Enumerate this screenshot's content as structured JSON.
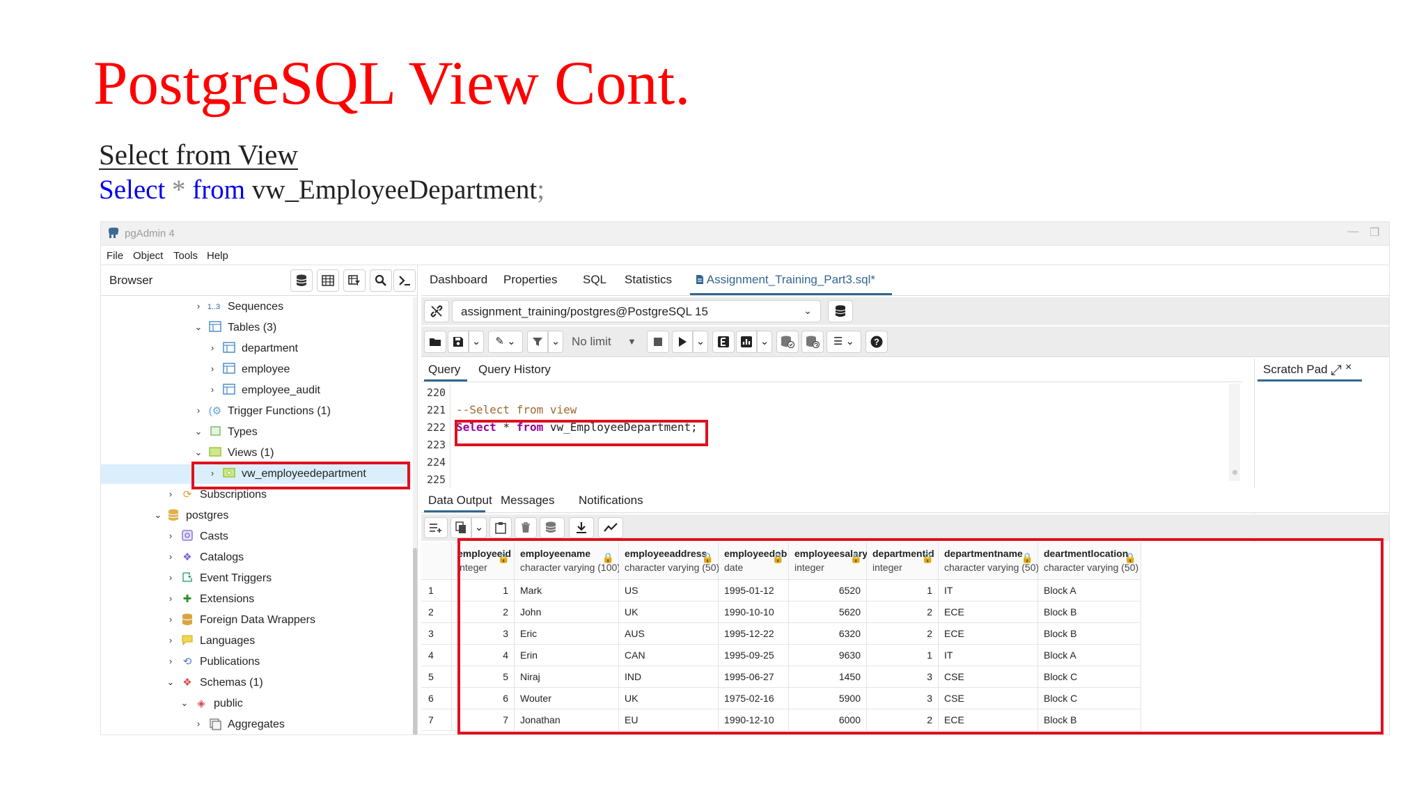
{
  "slide": {
    "title": "PostgreSQL View Cont.",
    "subtitle": "Select from View",
    "code": {
      "kw1": "Select",
      "op": " * ",
      "kw2": "from",
      "ident": " vw_EmployeeDepartment",
      "semi": ";"
    }
  },
  "window": {
    "app_name": "pgAdmin 4",
    "menu": [
      "File",
      "Object",
      "Tools",
      "Help"
    ]
  },
  "browser": {
    "title": "Browser",
    "tree": [
      {
        "label": "Sequences",
        "prefix": "1..3",
        "icon": "sequence-icon"
      },
      {
        "label": "Tables (3)",
        "icon": "table-icon"
      },
      {
        "label": "department",
        "icon": "table-icon"
      },
      {
        "label": "employee",
        "icon": "table-icon"
      },
      {
        "label": "employee_audit",
        "icon": "table-icon"
      },
      {
        "label": "Trigger Functions (1)",
        "icon": "trigger-function-icon"
      },
      {
        "label": "Types",
        "icon": "types-icon"
      },
      {
        "label": "Views (1)",
        "icon": "views-icon"
      },
      {
        "label": "vw_employeedepartment",
        "icon": "view-icon"
      },
      {
        "label": "Subscriptions",
        "icon": "subscriptions-icon"
      },
      {
        "label": "postgres",
        "icon": "database-icon"
      },
      {
        "label": "Casts",
        "icon": "casts-icon"
      },
      {
        "label": "Catalogs",
        "icon": "catalogs-icon"
      },
      {
        "label": "Event Triggers",
        "icon": "event-triggers-icon"
      },
      {
        "label": "Extensions",
        "icon": "extensions-icon"
      },
      {
        "label": "Foreign Data Wrappers",
        "icon": "fdw-icon"
      },
      {
        "label": "Languages",
        "icon": "languages-icon"
      },
      {
        "label": "Publications",
        "icon": "publications-icon"
      },
      {
        "label": "Schemas (1)",
        "icon": "schemas-icon"
      },
      {
        "label": "public",
        "icon": "schema-icon"
      },
      {
        "label": "Aggregates",
        "icon": "aggregates-icon"
      }
    ]
  },
  "main": {
    "tabs": [
      "Dashboard",
      "Properties",
      "SQL",
      "Statistics",
      "Assignment_Training_Part3.sql*"
    ],
    "connection": "assignment_training/postgres@PostgreSQL 15",
    "limit": "No limit",
    "query_tabs": [
      "Query",
      "Query History"
    ],
    "scratch_pad": "Scratch Pad",
    "scratch_close": "×",
    "editor": {
      "line_numbers": [
        "220",
        "221",
        "222",
        "223",
        "224",
        "225"
      ],
      "comment": "--Select from view",
      "kw_select": "Select",
      "op_star": " * ",
      "kw_from": "from",
      "ident": " vw_EmployeeDepartment;"
    },
    "output_tabs": [
      "Data Output",
      "Messages",
      "Notifications"
    ]
  },
  "result": {
    "columns": [
      {
        "name": "employeeid",
        "type": "integer",
        "align": "num"
      },
      {
        "name": "employeename",
        "type": "character varying (100)",
        "align": "txt"
      },
      {
        "name": "employeeaddress",
        "type": "character varying (50)",
        "align": "txt"
      },
      {
        "name": "employeedob",
        "type": "date",
        "align": "txt"
      },
      {
        "name": "employeesalary",
        "type": "integer",
        "align": "num"
      },
      {
        "name": "departmentid",
        "type": "integer",
        "align": "num"
      },
      {
        "name": "departmentname",
        "type": "character varying (50)",
        "align": "txt"
      },
      {
        "name": "deartmentlocation",
        "type": "character varying (50)",
        "align": "txt"
      }
    ],
    "rows": [
      [
        "1",
        "1",
        "Mark",
        "US",
        "1995-01-12",
        "6520",
        "1",
        "IT",
        "Block A"
      ],
      [
        "2",
        "2",
        "John",
        "UK",
        "1990-10-10",
        "5620",
        "2",
        "ECE",
        "Block B"
      ],
      [
        "3",
        "3",
        "Eric",
        "AUS",
        "1995-12-22",
        "6320",
        "2",
        "ECE",
        "Block B"
      ],
      [
        "4",
        "4",
        "Erin",
        "CAN",
        "1995-09-25",
        "9630",
        "1",
        "IT",
        "Block A"
      ],
      [
        "5",
        "5",
        "Niraj",
        "IND",
        "1995-06-27",
        "1450",
        "3",
        "CSE",
        "Block C"
      ],
      [
        "6",
        "6",
        "Wouter",
        "UK",
        "1975-02-16",
        "5900",
        "3",
        "CSE",
        "Block C"
      ],
      [
        "7",
        "7",
        "Jonathan",
        "EU",
        "1990-12-10",
        "6000",
        "2",
        "ECE",
        "Block B"
      ]
    ]
  },
  "colors": {
    "title_red": "#ff0000",
    "keyword_blue": "#0000ee",
    "highlight_red": "#e0101e",
    "pgadmin_blue": "#326690",
    "selection_bg": "#dbeefb"
  }
}
